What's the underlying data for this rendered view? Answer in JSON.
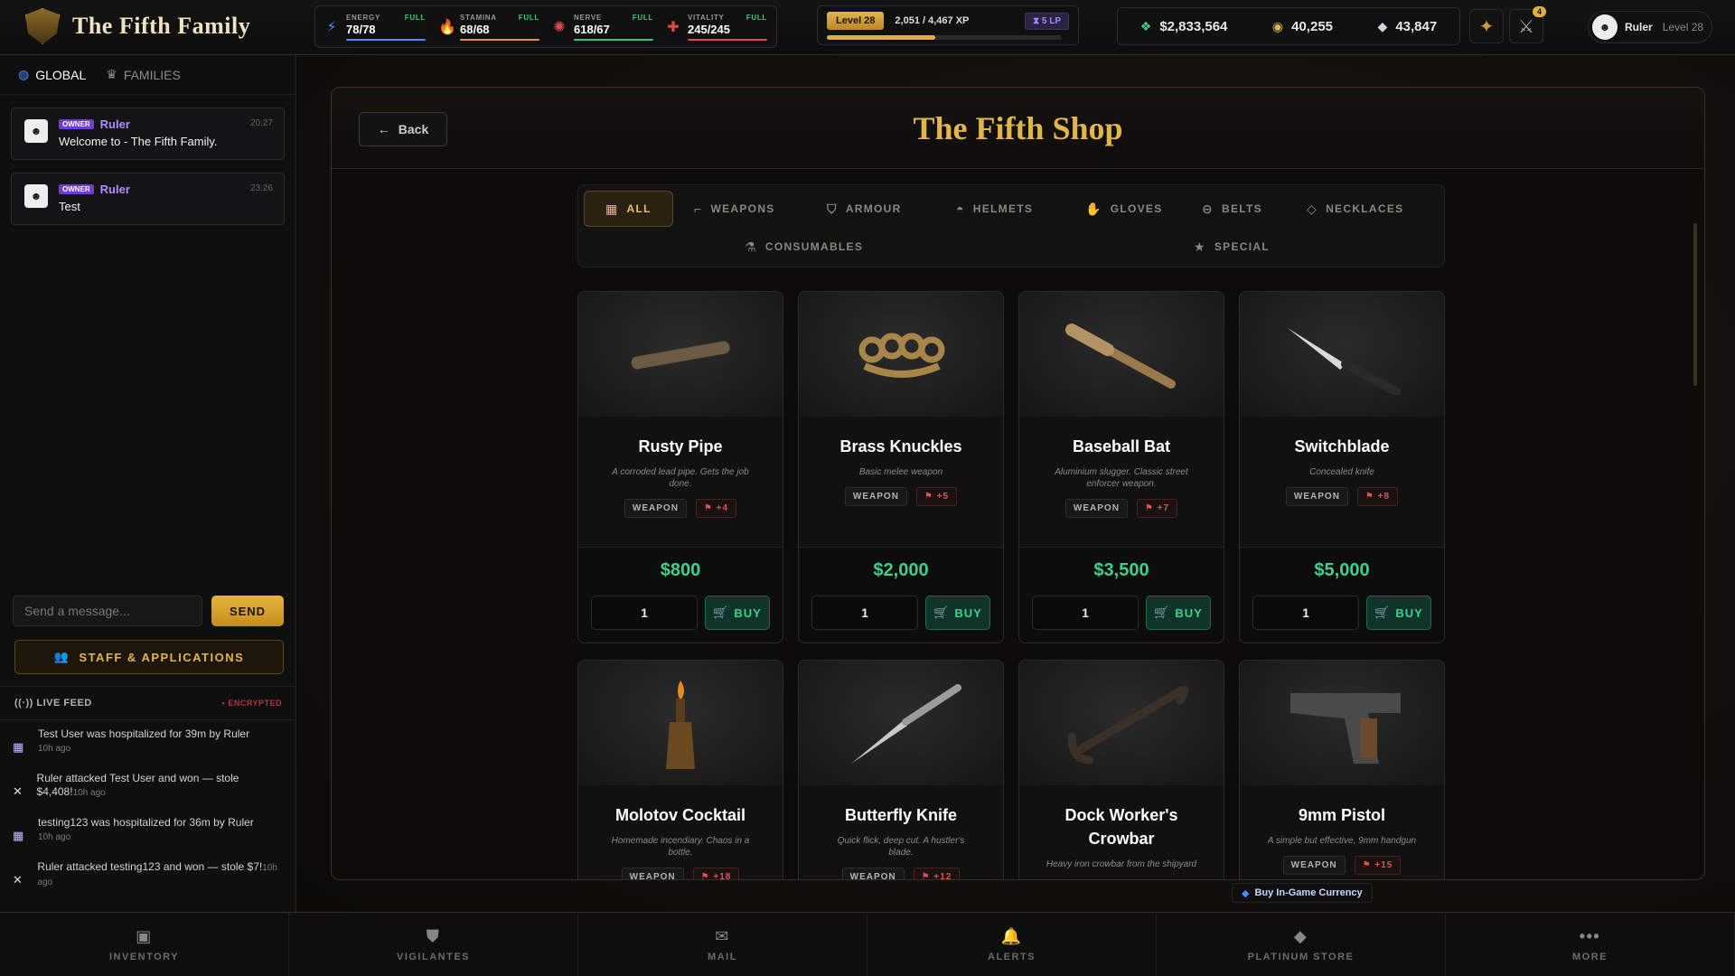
{
  "app": {
    "title": "The Fifth Family"
  },
  "stats": [
    {
      "label": "ENERGY",
      "status": "FULL",
      "value": "78/78",
      "icon": "lightning-icon",
      "color": "#4c8bff"
    },
    {
      "label": "STAMINA",
      "status": "FULL",
      "value": "68/68",
      "icon": "flame-icon",
      "color": "#f0913a"
    },
    {
      "label": "NERVE",
      "status": "FULL",
      "value": "618/67",
      "icon": "brain-icon",
      "color": "#e04a4a"
    },
    {
      "label": "VITALITY",
      "status": "FULL",
      "value": "245/245",
      "icon": "heart-pulse-icon",
      "color": "#e04a4a"
    }
  ],
  "level": {
    "label": "Level 28",
    "xp": "2,051 / 4,467 XP",
    "slp": "5 LP",
    "progress": 0.46
  },
  "currency": {
    "cash": "$2,833,564",
    "coins": "40,255",
    "gems": "43,847"
  },
  "notifications": {
    "count": "4"
  },
  "user": {
    "name": "Ruler",
    "level": "Level 28"
  },
  "chat": {
    "tabs": [
      {
        "label": "GLOBAL"
      },
      {
        "label": "FAMILIES"
      }
    ],
    "messages": [
      {
        "role": "OWNER",
        "name": "Ruler",
        "time": "20:27",
        "text": "Welcome to - The Fifth Family."
      },
      {
        "role": "OWNER",
        "name": "Ruler",
        "time": "23:26",
        "text": "Test"
      }
    ],
    "placeholder": "Send a message...",
    "send_label": "SEND",
    "staff_label": "STAFF & APPLICATIONS"
  },
  "feed": {
    "title": "LIVE FEED",
    "encrypted": "• ENCRYPTED",
    "items": [
      {
        "text": "Test User was hospitalized for 39m by Ruler",
        "ago": "10h ago"
      },
      {
        "text": "Ruler attacked Test User and won — stole $4,408!",
        "ago": "10h ago"
      },
      {
        "text": "testing123 was hospitalized for 36m by Ruler",
        "ago": "10h ago"
      },
      {
        "text": "Ruler attacked testing123 and won — stole $7!",
        "ago": "10h ago"
      }
    ]
  },
  "shop": {
    "back_label": "Back",
    "title": "The Fifth Shop",
    "categories": [
      {
        "label": "ALL"
      },
      {
        "label": "WEAPONS"
      },
      {
        "label": "ARMOUR"
      },
      {
        "label": "HELMETS"
      },
      {
        "label": "GLOVES"
      },
      {
        "label": "BELTS"
      },
      {
        "label": "NECKLACES"
      },
      {
        "label": "CONSUMABLES"
      },
      {
        "label": "SPECIAL"
      }
    ],
    "buy_label": "BUY",
    "items": [
      {
        "name": "Rusty Pipe",
        "desc": "A corroded lead pipe. Gets the job done.",
        "type": "WEAPON",
        "bonus": "+4",
        "price": "$800",
        "qty": "1"
      },
      {
        "name": "Brass Knuckles",
        "desc": "Basic melee weapon",
        "type": "WEAPON",
        "bonus": "+5",
        "price": "$2,000",
        "qty": "1"
      },
      {
        "name": "Baseball Bat",
        "desc": "Aluminium slugger. Classic street enforcer weapon.",
        "type": "WEAPON",
        "bonus": "+7",
        "price": "$3,500",
        "qty": "1"
      },
      {
        "name": "Switchblade",
        "desc": "Concealed knife",
        "type": "WEAPON",
        "bonus": "+8",
        "price": "$5,000",
        "qty": "1"
      },
      {
        "name": "Molotov Cocktail",
        "desc": "Homemade incendiary. Chaos in a bottle.",
        "type": "WEAPON",
        "bonus": "+18"
      },
      {
        "name": "Butterfly Knife",
        "desc": "Quick flick, deep cut. A hustler's blade.",
        "type": "WEAPON",
        "bonus": "+12"
      },
      {
        "name": "Dock Worker's Crowbar",
        "desc": "Heavy iron crowbar from the shipyard"
      },
      {
        "name": "9mm Pistol",
        "desc": "A simple but effective, 9mm handgun",
        "type": "WEAPON",
        "bonus": "+15"
      }
    ],
    "buy_currency": "Buy In-Game Currency"
  },
  "bottom_nav": [
    {
      "label": "INVENTORY"
    },
    {
      "label": "VIGILANTES"
    },
    {
      "label": "MAIL"
    },
    {
      "label": "ALERTS"
    },
    {
      "label": "PLATINUM STORE"
    },
    {
      "label": "MORE"
    }
  ]
}
